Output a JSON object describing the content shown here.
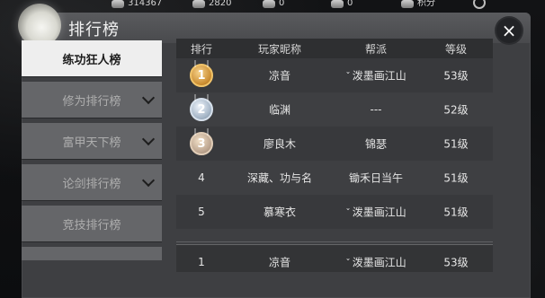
{
  "topbar": {
    "items": [
      {
        "value": "314367",
        "icon": "coin-icon"
      },
      {
        "value": "2820",
        "icon": "gem-icon"
      },
      {
        "value": "0",
        "icon": "token-icon"
      },
      {
        "value": "0",
        "icon": "ticket-icon"
      },
      {
        "value": "积分",
        "icon": "points-icon"
      }
    ]
  },
  "panel": {
    "title": "排行榜",
    "close_label": "×"
  },
  "sidebar": {
    "items": [
      {
        "label": "练功狂人榜",
        "active": true
      },
      {
        "label": "修为排行榜",
        "active": false
      },
      {
        "label": "富甲天下榜",
        "active": false
      },
      {
        "label": "论剑排行榜",
        "active": false
      },
      {
        "label": "竞技排行榜",
        "active": false
      },
      {
        "label": "",
        "active": false
      }
    ]
  },
  "table": {
    "headers": {
      "rank": "排行",
      "name": "玩家昵称",
      "guild": "帮派",
      "level": "等级"
    },
    "rows": [
      {
        "rank": "1",
        "name": "凉音",
        "guild": "泼墨画江山",
        "level": "53级",
        "medal": "gold"
      },
      {
        "rank": "2",
        "name": "临渊",
        "guild": "---",
        "level": "52级",
        "medal": "silver"
      },
      {
        "rank": "3",
        "name": "廖良木",
        "guild": "锦瑟",
        "level": "51级",
        "medal": "bronze"
      },
      {
        "rank": "4",
        "name": "深藏、功与名",
        "guild": "锄禾日当午",
        "level": "51级",
        "medal": ""
      },
      {
        "rank": "5",
        "name": "慕寒衣",
        "guild": "泼墨画江山",
        "level": "51级",
        "medal": ""
      }
    ],
    "my_row": {
      "rank": "1",
      "name": "凉音",
      "guild": "泼墨画江山",
      "level": "53级"
    }
  },
  "colors": {
    "panel": "#3e3f42",
    "active_tab": "#eeeeee",
    "inactive_tab": "#656669"
  }
}
